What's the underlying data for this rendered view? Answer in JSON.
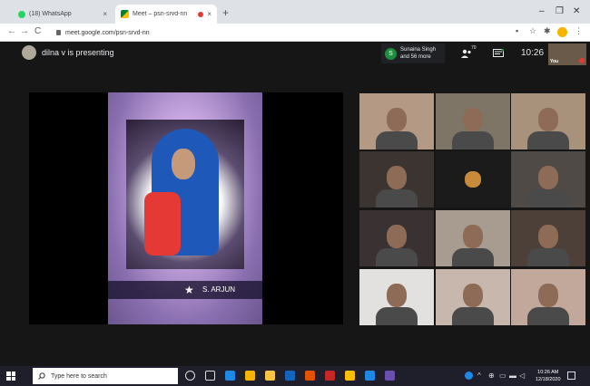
{
  "browser": {
    "tabs": [
      {
        "label": "(18) WhatsApp",
        "icon": "whatsapp-icon"
      },
      {
        "label": "Meet – psn-srvd-nn",
        "icon": "google-meet-icon"
      }
    ],
    "new_tab": "+",
    "tab_close": "×",
    "window_controls": {
      "minimize": "–",
      "restore": "❐",
      "close": "✕"
    },
    "nav": {
      "back": "←",
      "forward": "→",
      "reload": "C"
    },
    "url": "meet.google.com/psn-srvd-nn",
    "extension_glyphs": [
      "▪",
      "☆",
      "✱"
    ],
    "menu": "⋮"
  },
  "meet": {
    "presenting_text": "dilna v is presenting",
    "notification": {
      "avatar_letter": "S",
      "line1": "Sunaina Singh",
      "line2": "and 56 more"
    },
    "participant_count": "70",
    "time": "10:26",
    "self_label": "You",
    "slide_caption": "S. ARJUN",
    "tile_backgrounds": [
      "#b49a84",
      "#7e7567",
      "#a8927c",
      "#3b3430",
      "#1b1b1b",
      "#4f4a45",
      "#3a3232",
      "#a89b8f",
      "#4c4038",
      "#e3e1df",
      "#c8b7ac",
      "#c2a89a"
    ]
  },
  "taskbar": {
    "search_placeholder": "Type here to search",
    "app_colors": [
      "#dddddd",
      "#dddddd",
      "#1e88e5",
      "#f4b400",
      "#f6c343",
      "#1565c0",
      "#e65100",
      "#c62828",
      "#fbbc04",
      "#1e88e5",
      "#6a4fb0"
    ],
    "tray_glyphs": [
      "^",
      "⊕",
      "▭",
      "▬",
      "◁",
      "⊲"
    ],
    "clock_time": "10:26 AM",
    "clock_date": "12/18/2020"
  },
  "colors": {
    "meet_background": "#161616",
    "taskbar_background": "#1f1f2b",
    "notification_avatar": "#1e8e3e"
  }
}
